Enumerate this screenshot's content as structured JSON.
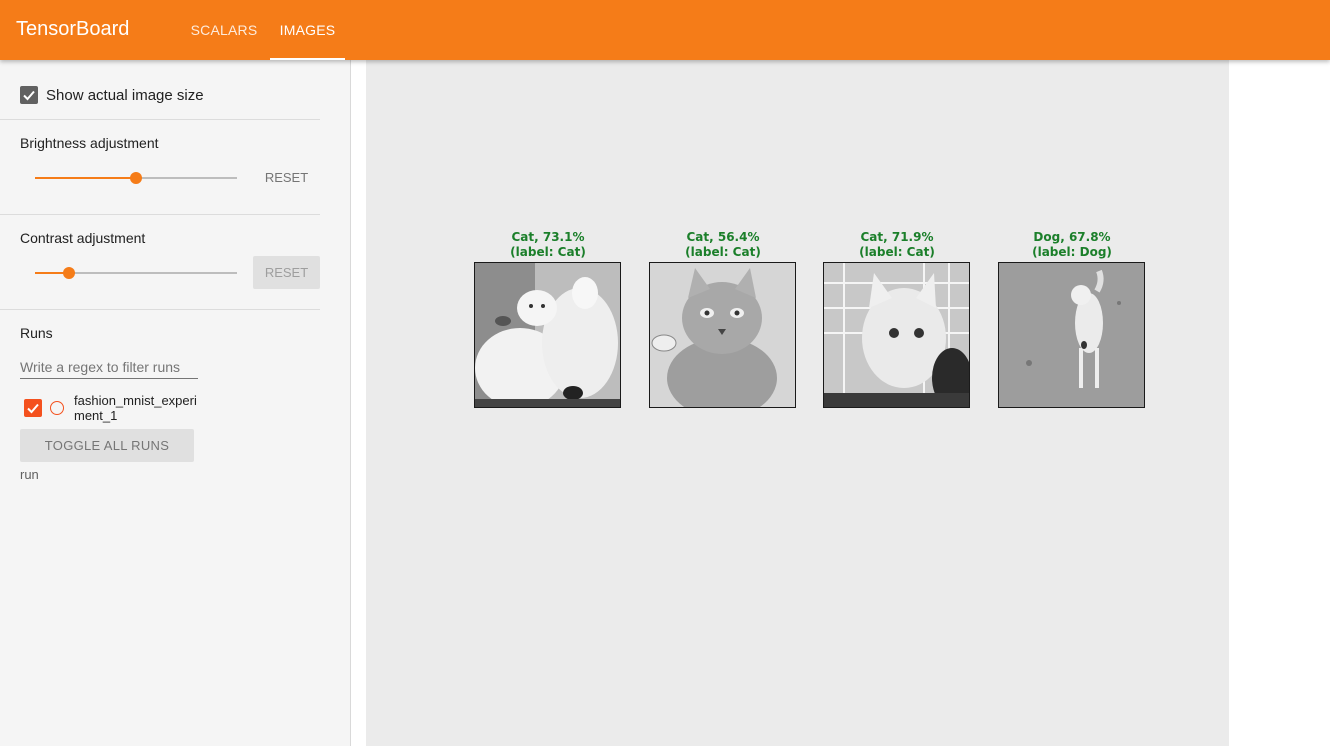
{
  "app": {
    "title": "TensorBoard",
    "tabs": [
      {
        "label": "SCALARS",
        "active": false
      },
      {
        "label": "IMAGES",
        "active": true
      }
    ],
    "accent_color": "#f57c18"
  },
  "sidebar": {
    "show_actual_size": {
      "label": "Show actual image size",
      "checked": true
    },
    "brightness": {
      "label": "Brightness adjustment",
      "value": 0.5,
      "reset_label": "RESET"
    },
    "contrast": {
      "label": "Contrast adjustment",
      "value": 0.17,
      "reset_label": "RESET"
    },
    "runs": {
      "title": "Runs",
      "filter_placeholder": "Write a regex to filter runs",
      "items": [
        {
          "name_line1": "fashion_mnist_experi",
          "name_line2": "ment_1",
          "checked": true
        }
      ],
      "toggle_label": "TOGGLE ALL RUNS",
      "footer_label": "run"
    }
  },
  "images": [
    {
      "line1": "Cat, 73.1%",
      "line2": "(label: Cat)",
      "icon": "cat-image"
    },
    {
      "line1": "Cat, 56.4%",
      "line2": "(label: Cat)",
      "icon": "cat-image"
    },
    {
      "line1": "Cat, 71.9%",
      "line2": "(label: Cat)",
      "icon": "cat-image"
    },
    {
      "line1": "Dog, 67.8%",
      "line2": "(label: Dog)",
      "icon": "dog-image"
    }
  ],
  "caption_color": "#1b7f2a"
}
